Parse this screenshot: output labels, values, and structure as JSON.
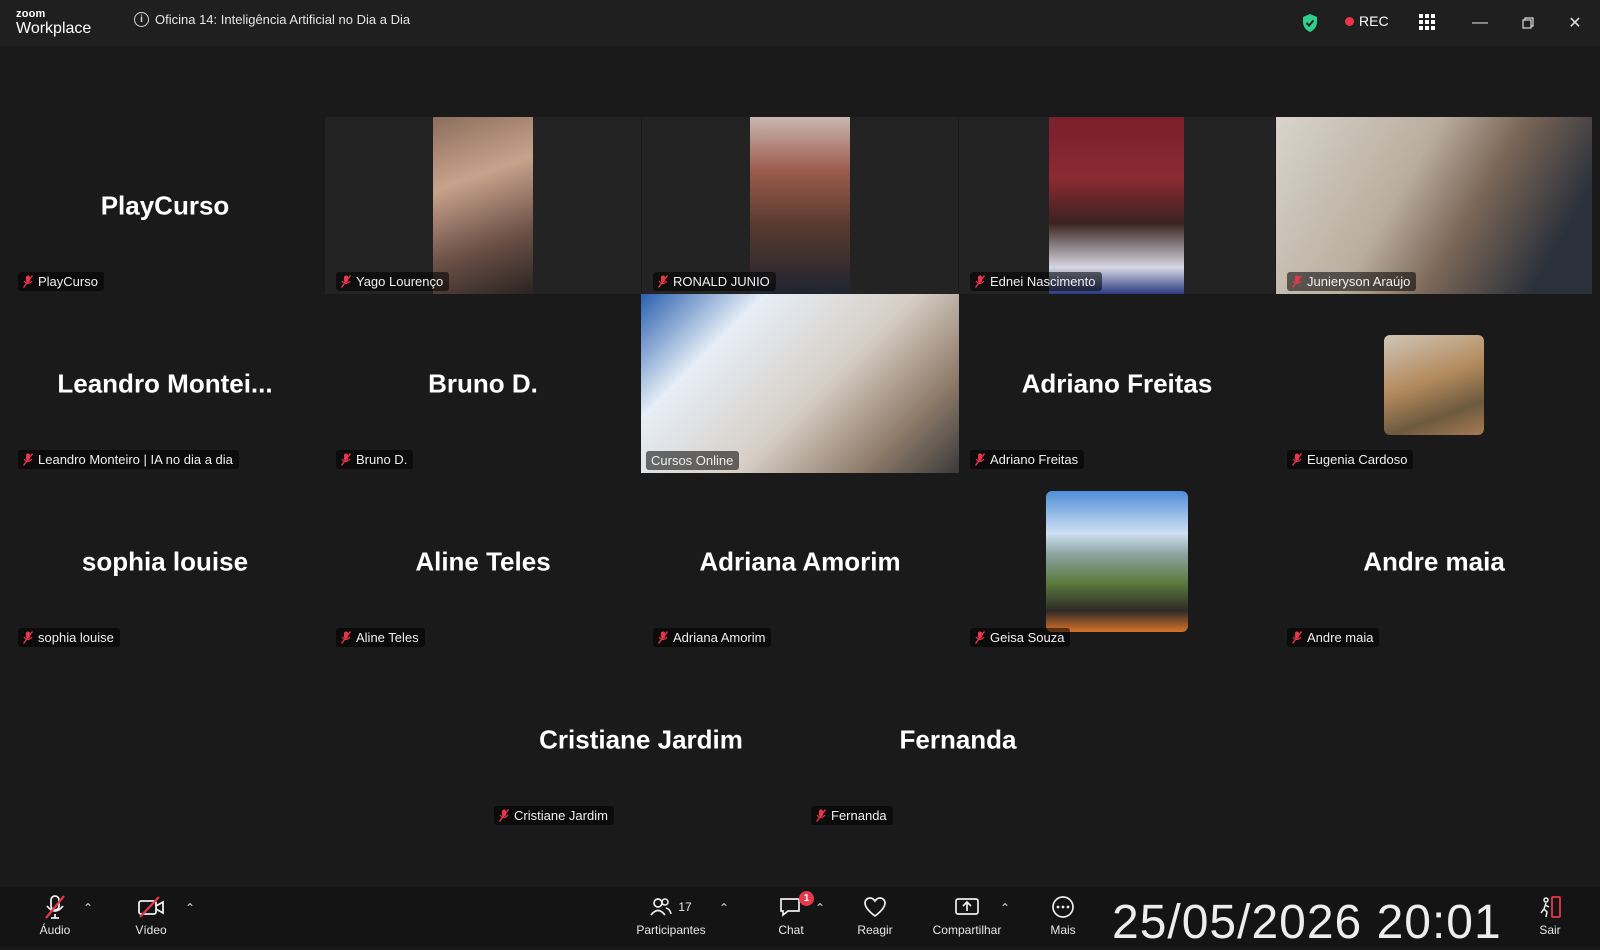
{
  "app": {
    "brand_small": "zoom",
    "brand_large": "Workplace"
  },
  "meeting": {
    "title": "Oficina 14: Inteligência Artificial no Dia a Dia",
    "rec_label": "REC"
  },
  "participants": [
    {
      "name": "PlayCurso",
      "big_name": "PlayCurso",
      "video": false
    },
    {
      "name": "Yago Lourenço",
      "video": true
    },
    {
      "name": "RONALD JUNIO",
      "video": true
    },
    {
      "name": "Ednei Nascimento",
      "video": true
    },
    {
      "name": "Junieryson Araújo",
      "video": true
    },
    {
      "name": "Leandro Monteiro | IA no dia a dia",
      "big_name": "Leandro  Montei...",
      "video": false
    },
    {
      "name": "Bruno D.",
      "big_name": "Bruno D.",
      "video": false
    },
    {
      "name": "Cursos Online",
      "video": true,
      "active_speaker": true
    },
    {
      "name": "Adriano Freitas",
      "big_name": "Adriano Freitas",
      "video": false
    },
    {
      "name": "Eugenia Cardoso",
      "video": false,
      "avatar_photo": true
    },
    {
      "name": "sophia louise",
      "big_name": "sophia louise",
      "video": false
    },
    {
      "name": "Aline Teles",
      "big_name": "Aline Teles",
      "video": false
    },
    {
      "name": "Adriana Amorim",
      "big_name": "Adriana Amorim",
      "video": false
    },
    {
      "name": "Geisa Souza",
      "video": false,
      "avatar_photo": true
    },
    {
      "name": "Andre maia",
      "big_name": "Andre maia",
      "video": false
    },
    {
      "name": "Cristiane Jardim",
      "big_name": "Cristiane Jardim",
      "video": false
    },
    {
      "name": "Fernanda",
      "big_name": "Fernanda",
      "video": false
    }
  ],
  "toolbar": {
    "audio_label": "Áudio",
    "video_label": "Vídeo",
    "participants_label": "Participantes",
    "participants_count": "17",
    "chat_label": "Chat",
    "chat_badge": "1",
    "react_label": "Reagir",
    "share_label": "Compartilhar",
    "more_label": "Mais",
    "leave_label": "Sair"
  },
  "overlay_clock": "25/05/2026 20:01",
  "colors": {
    "active_speaker": "#2fd08b",
    "rec_dot": "#e8374a",
    "shield": "#2fd08b",
    "mic_off": "#e8374a"
  }
}
